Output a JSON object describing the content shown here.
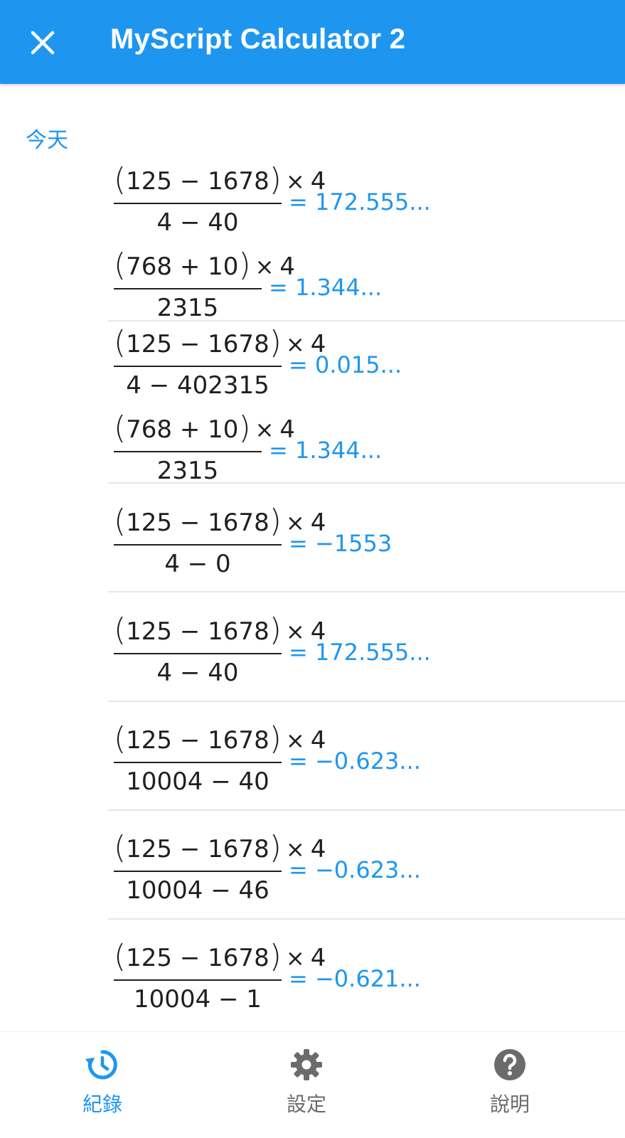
{
  "app_bar": {
    "title": "MyScript Calculator 2",
    "close_icon": "close-icon"
  },
  "colors": {
    "accent": "#1e96f0",
    "text": "#1f1f1f",
    "muted": "#6b6b6b",
    "divider": "#e6e6e6"
  },
  "history": {
    "section_label": "今天",
    "entries": [
      {
        "numerator": [
          "125 − 1678",
          "4"
        ],
        "denominator": "4 − 40",
        "result": "= 172.555..."
      },
      {
        "numerator": [
          "768 + 10",
          "4"
        ],
        "denominator": "2315",
        "result": "= 1.344..."
      },
      {
        "numerator": [
          "125 − 1678",
          "4"
        ],
        "denominator": "4 − 402315",
        "result": "= 0.015..."
      },
      {
        "numerator": [
          "768 + 10",
          "4"
        ],
        "denominator": "2315",
        "result": "= 1.344..."
      },
      {
        "numerator": [
          "125 − 1678",
          "4"
        ],
        "denominator": "4 − 0",
        "result": "= −1553"
      },
      {
        "numerator": [
          "125 − 1678",
          "4"
        ],
        "denominator": "4 − 40",
        "result": "= 172.555..."
      },
      {
        "numerator": [
          "125 − 1678",
          "4"
        ],
        "denominator": "10004 − 40",
        "result": "= −0.623..."
      },
      {
        "numerator": [
          "125 − 1678",
          "4"
        ],
        "denominator": "10004 − 46",
        "result": "= −0.623..."
      },
      {
        "numerator": [
          "125 − 1678",
          "4"
        ],
        "denominator": "10004 − 1",
        "result": "= −0.621..."
      }
    ]
  },
  "bottom_nav": {
    "items": [
      {
        "label": "紀錄",
        "icon": "history-icon",
        "active": true
      },
      {
        "label": "設定",
        "icon": "gear-icon",
        "active": false
      },
      {
        "label": "說明",
        "icon": "help-icon",
        "active": false
      }
    ]
  }
}
